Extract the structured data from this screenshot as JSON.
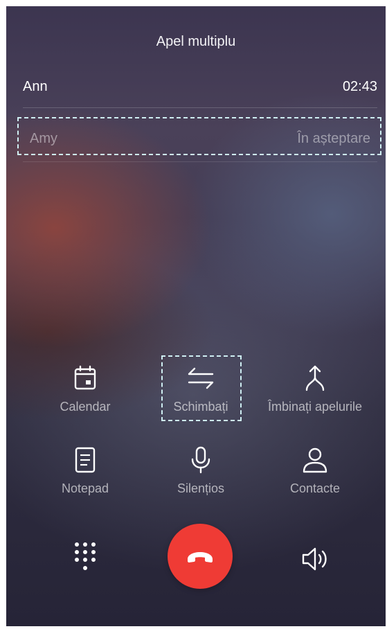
{
  "header": {
    "title": "Apel multiplu"
  },
  "calls": [
    {
      "name": "Ann",
      "status": "02:43"
    },
    {
      "name": "Amy",
      "status": "În așteptare"
    }
  ],
  "actions": {
    "calendar": "Calendar",
    "swap": "Schimbați",
    "merge": "Îmbinați apelurile",
    "notepad": "Notepad",
    "mute": "Silențios",
    "contacts": "Contacte"
  },
  "colors": {
    "end_call": "#ef3b35",
    "highlight": "#cfeff3"
  },
  "icons": {
    "calendar": "calendar-icon",
    "swap": "swap-arrows-icon",
    "merge": "merge-icon",
    "notepad": "notepad-icon",
    "mute": "microphone-icon",
    "contacts": "person-icon",
    "dialpad": "dialpad-icon",
    "end_call": "end-call-icon",
    "speaker": "speaker-icon"
  }
}
